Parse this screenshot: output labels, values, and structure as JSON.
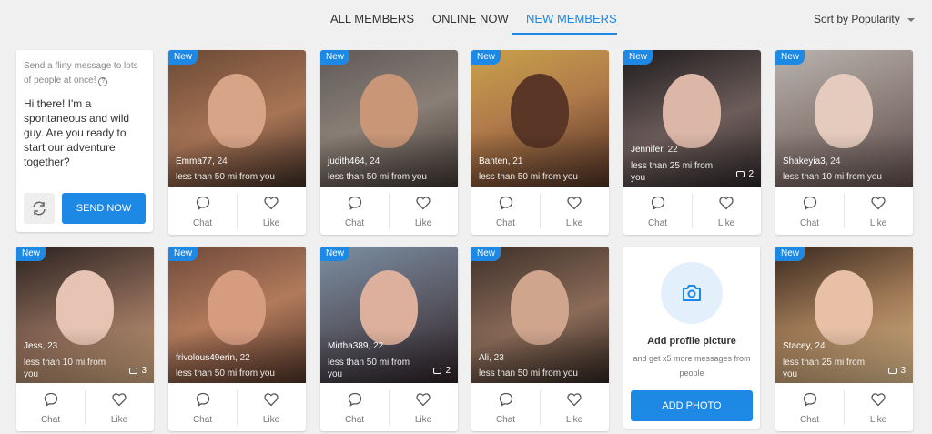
{
  "tabs": [
    {
      "label": "ALL MEMBERS"
    },
    {
      "label": "ONLINE NOW"
    },
    {
      "label": "NEW MEMBERS",
      "active": true
    }
  ],
  "sort": {
    "label": "Sort by Popularity"
  },
  "message_card": {
    "hint": "Send a flirty message to lots of people at once!",
    "message": "Hi there! I'm a spontaneous and wild guy. Are you ready to start our adventure together?",
    "send_label": "SEND NOW"
  },
  "add_photo": {
    "title": "Add profile picture",
    "subtitle": "and get x5 more messages from people",
    "button_label": "ADD PHOTO"
  },
  "action_labels": {
    "chat": "Chat",
    "like": "Like"
  },
  "badge_label": "New",
  "members": [
    {
      "name": "Emma77",
      "age": ", 24",
      "distance": "less than 50 mi from you",
      "new": true
    },
    {
      "name": "judith464",
      "age": ", 24",
      "distance": "less than 50 mi from you",
      "new": true
    },
    {
      "name": "Banten",
      "age": ", 21",
      "distance": "less than 50 mi from you",
      "new": true
    },
    {
      "name": "Jennifer",
      "age": ", 22",
      "distance": "less than 25 mi from you",
      "new": true,
      "photos": "2"
    },
    {
      "name": "Shakeyia3",
      "age": ", 24",
      "distance": "less than 10 mi from you",
      "new": true
    },
    {
      "name": "Jess",
      "age": ", 23",
      "distance": "less than 10 mi from you",
      "new": true,
      "photos": "3"
    },
    {
      "name": "frivolous49erin",
      "age": ", 22",
      "distance": "less than 50 mi from you",
      "new": true
    },
    {
      "name": "Mirtha389",
      "age": ", 22",
      "distance": "less than 50 mi from you",
      "new": true,
      "photos": "2"
    },
    {
      "name": "Ali",
      "age": ", 23",
      "distance": "less than 50 mi from you",
      "new": true
    },
    {
      "name": "Stacey",
      "age": ", 24",
      "distance": "less than 25 mi from you",
      "new": true,
      "photos": "3"
    }
  ],
  "colors": {
    "accent": "#1e88e5",
    "background": "#f0f0f0"
  }
}
